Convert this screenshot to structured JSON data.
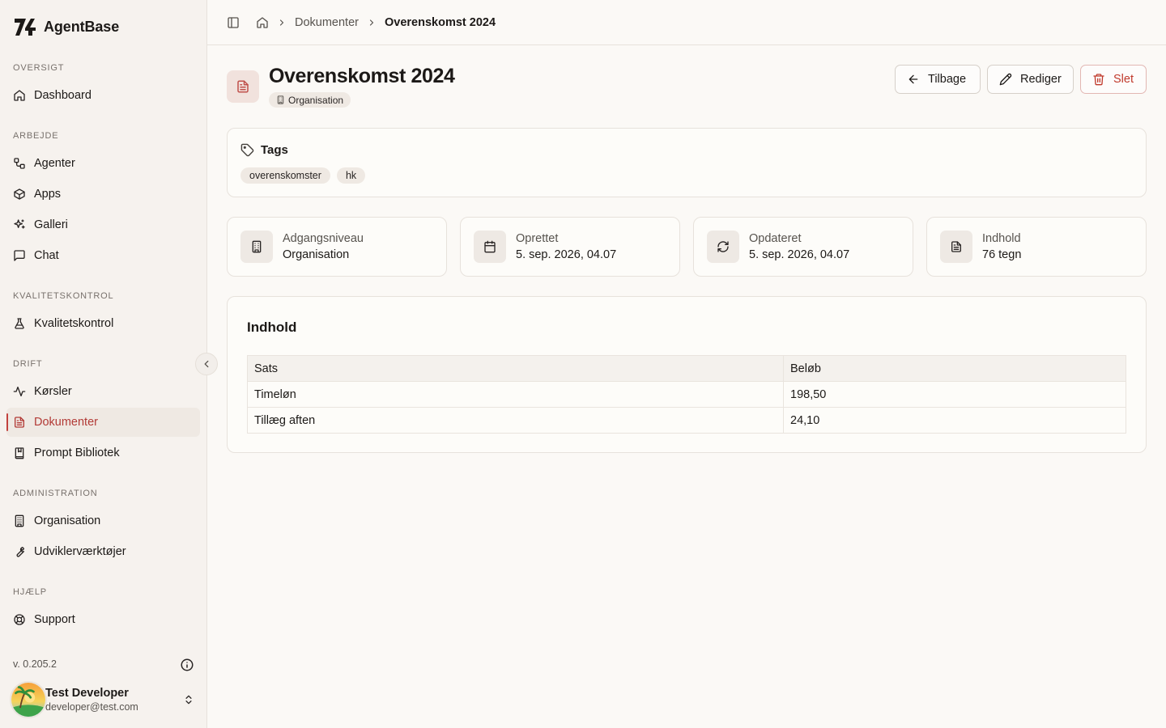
{
  "brand": {
    "name": "AgentBase"
  },
  "sidebar": {
    "sections": {
      "oversigt": "OVERSIGT",
      "arbejde": "ARBEJDE",
      "kvalitet": "KVALITETSKONTROL",
      "drift": "DRIFT",
      "administration": "ADMINISTRATION",
      "hjaelp": "HJÆLP"
    },
    "items": {
      "dashboard": {
        "label": "Dashboard",
        "icon": "home-icon"
      },
      "agenter": {
        "label": "Agenter",
        "icon": "workflow-icon"
      },
      "apps": {
        "label": "Apps",
        "icon": "box-icon"
      },
      "galleri": {
        "label": "Galleri",
        "icon": "sparkles-icon"
      },
      "chat": {
        "label": "Chat",
        "icon": "message-square-icon"
      },
      "kvalitetskontrol": {
        "label": "Kvalitetskontrol",
        "icon": "flask-icon"
      },
      "koersler": {
        "label": "Kørsler",
        "icon": "activity-icon"
      },
      "dokumenter": {
        "label": "Dokumenter",
        "icon": "file-text-icon",
        "active": true
      },
      "prompt": {
        "label": "Prompt Bibliotek",
        "icon": "book-icon"
      },
      "organisation": {
        "label": "Organisation",
        "icon": "building-icon"
      },
      "udvikler": {
        "label": "Udviklerværktøjer",
        "icon": "wrench-icon"
      },
      "support": {
        "label": "Support",
        "icon": "life-buoy-icon"
      }
    },
    "version": "v. 0.205.2",
    "user": {
      "name": "Test Developer",
      "email": "developer@test.com"
    }
  },
  "breadcrumb": {
    "parent": "Dokumenter",
    "current": "Overenskomst 2024"
  },
  "header": {
    "title": "Overenskomst 2024",
    "badge": "Organisation",
    "buttons": {
      "back": "Tilbage",
      "edit": "Rediger",
      "delete": "Slet"
    }
  },
  "tags": {
    "heading": "Tags",
    "items": [
      "overenskomster",
      "hk"
    ]
  },
  "stats": [
    {
      "label": "Adgangsniveau",
      "value": "Organisation",
      "icon": "building-icon"
    },
    {
      "label": "Oprettet",
      "value": "5. sep. 2026, 04.07",
      "icon": "calendar-icon"
    },
    {
      "label": "Opdateret",
      "value": "5. sep. 2026, 04.07",
      "icon": "refresh-icon"
    },
    {
      "label": "Indhold",
      "value": "76 tegn",
      "icon": "file-text-icon"
    }
  ],
  "content": {
    "heading": "Indhold",
    "table": {
      "headers": [
        "Sats",
        "Beløb"
      ],
      "rows": [
        [
          "Timeløn",
          "198,50"
        ],
        [
          "Tillæg aften",
          "24,10"
        ]
      ]
    }
  },
  "colors": {
    "accent": "#c0392b",
    "sidebar_bg": "#f6f2ee",
    "page_bg": "#fbf9f6"
  }
}
